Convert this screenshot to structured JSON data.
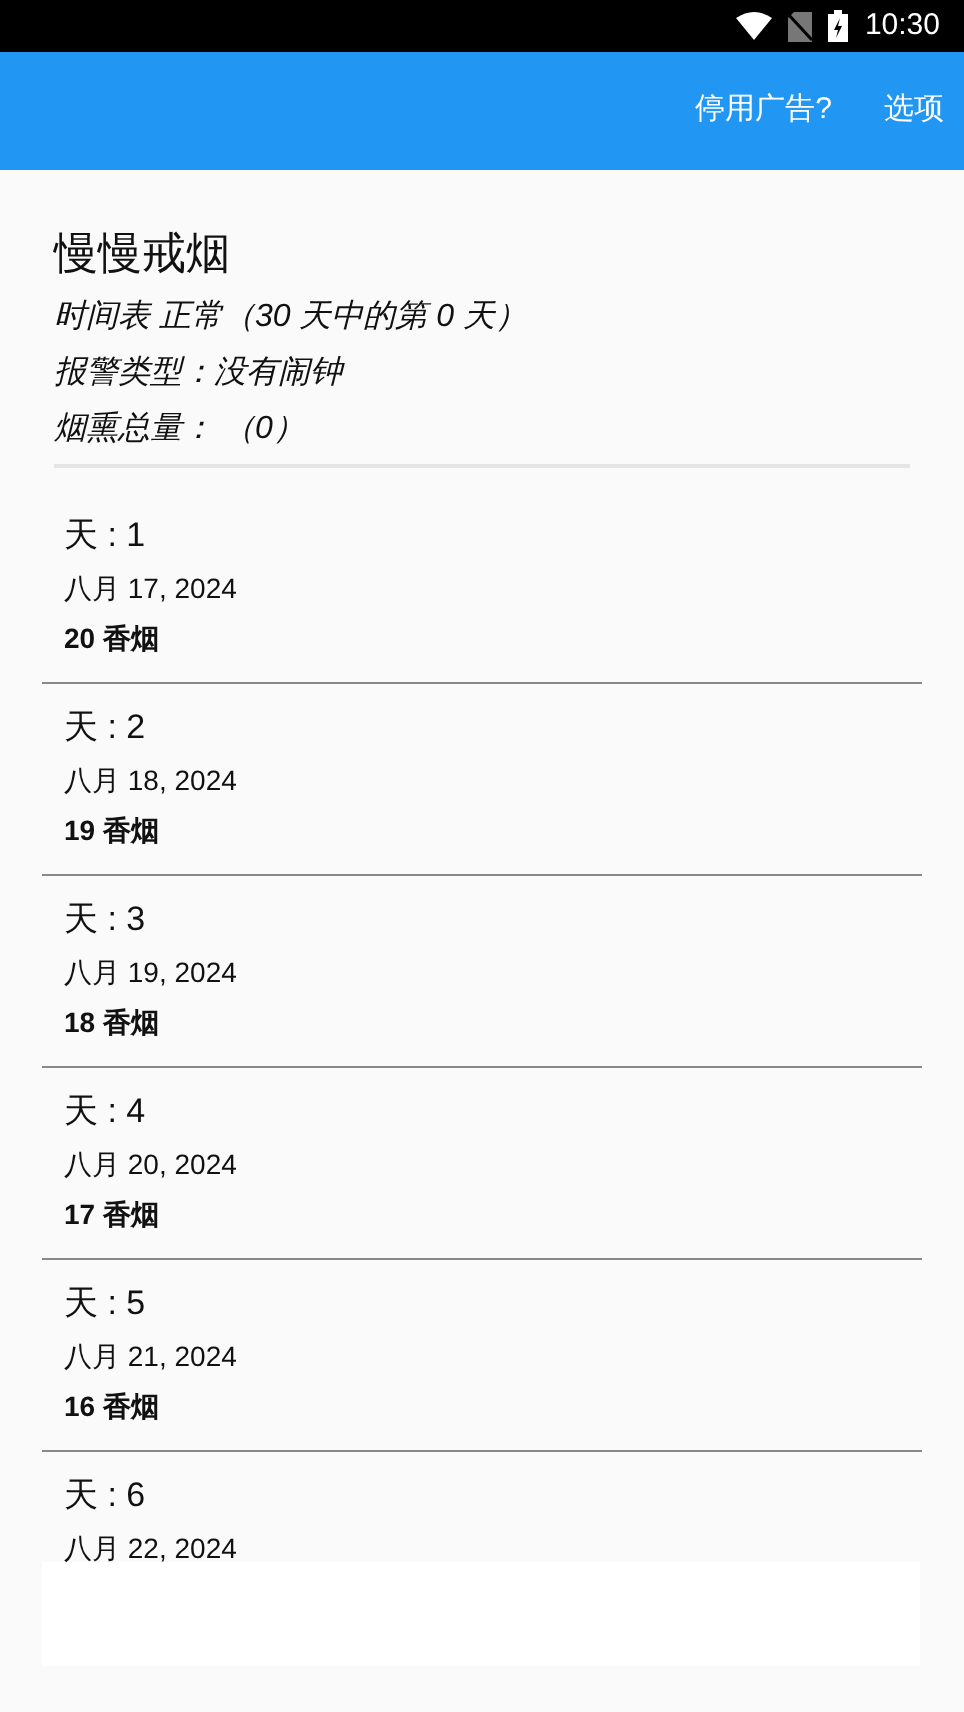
{
  "status_bar": {
    "time": "10:30"
  },
  "app_bar": {
    "actions": [
      "停用广告?",
      "选项"
    ]
  },
  "plan": {
    "title": "慢慢戒烟",
    "schedule": "时间表 正常（30 天中的第 0 天）",
    "alarm": "报警类型：没有闹钟",
    "total": "烟熏总量：  （0）"
  },
  "days": [
    {
      "day": "天 : 1",
      "date": "八月 17, 2024",
      "count": "20 香烟"
    },
    {
      "day": "天 : 2",
      "date": "八月 18, 2024",
      "count": "19 香烟"
    },
    {
      "day": "天 : 3",
      "date": "八月 19, 2024",
      "count": "18 香烟"
    },
    {
      "day": "天 : 4",
      "date": "八月 20, 2024",
      "count": "17 香烟"
    },
    {
      "day": "天 : 5",
      "date": "八月 21, 2024",
      "count": "16 香烟"
    },
    {
      "day": "天 : 6",
      "date": "八月 22, 2024"
    }
  ]
}
